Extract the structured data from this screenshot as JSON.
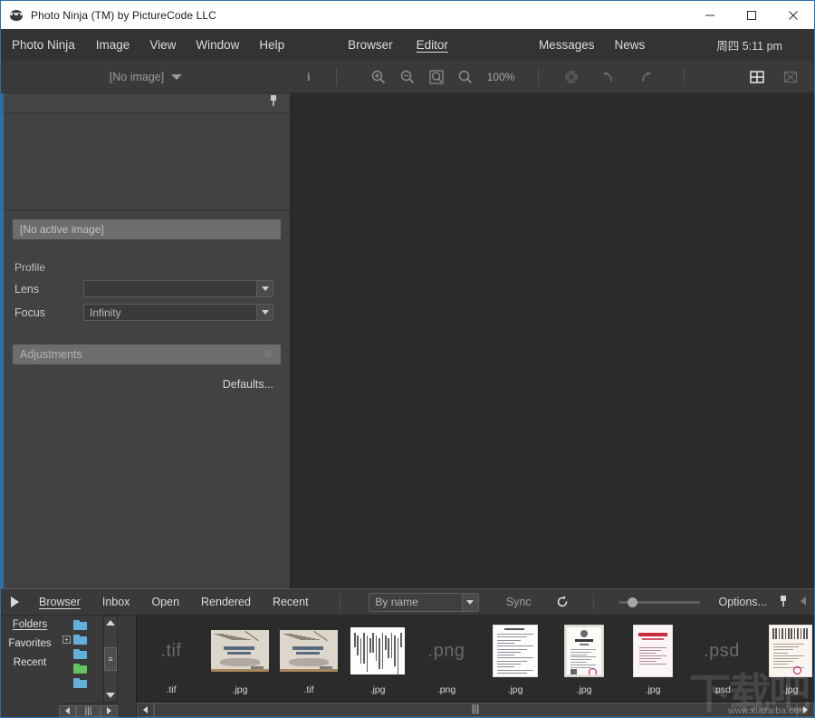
{
  "window": {
    "title": "Photo Ninja (TM) by PictureCode LLC",
    "app_icon": "ninja-icon",
    "minimize_label": "Minimize",
    "maximize_label": "Maximize",
    "close_label": "Close"
  },
  "menubar": {
    "menus": [
      {
        "label": "Photo Ninja"
      },
      {
        "label": "Image"
      },
      {
        "label": "View"
      },
      {
        "label": "Window"
      },
      {
        "label": "Help"
      }
    ],
    "modes": [
      {
        "label": "Browser",
        "active": false
      },
      {
        "label": "Editor",
        "active": true
      }
    ],
    "links": [
      {
        "label": "Messages"
      },
      {
        "label": "News"
      }
    ],
    "clock": "周四 5:11 pm",
    "collapse_icon": "chevron-up-icon",
    "pin_icon": "pin-icon"
  },
  "toolbar": {
    "image_selector": "[No image]",
    "dropdown_icon": "chevron-down-icon",
    "info_icon": "info-icon",
    "zoom_in_icon": "zoom-in-icon",
    "zoom_out_icon": "zoom-out-icon",
    "zoom_fit_icon": "zoom-fit-icon",
    "zoom_actual_icon": "zoom-actual-icon",
    "zoom_level": "100%",
    "pan_icon": "pan-icon",
    "undo_icon": "undo-icon",
    "redo_icon": "redo-icon",
    "grid_view_icon": "grid-view-icon",
    "single_view_icon": "single-view-icon"
  },
  "left_panel": {
    "pin_icon": "pin-icon",
    "active_image": "[No active image]",
    "profile_label": "Profile",
    "fields": [
      {
        "label": "Lens",
        "value": ""
      },
      {
        "label": "Focus",
        "value": "Infinity"
      }
    ],
    "adjustments_label": "Adjustments",
    "adjustments_icon": "gear-icon",
    "defaults_label": "Defaults..."
  },
  "browser_bar": {
    "expand_icon": "triangle-right-icon",
    "tabs": [
      {
        "label": "Browser",
        "active": true
      },
      {
        "label": "Inbox",
        "active": false
      },
      {
        "label": "Open",
        "active": false
      },
      {
        "label": "Rendered",
        "active": false
      },
      {
        "label": "Recent",
        "active": false
      }
    ],
    "sort_value": "By name",
    "sort_dropdown_icon": "chevron-down-icon",
    "sync_label": "Sync",
    "refresh_icon": "refresh-icon",
    "zoom_slider_value": 15,
    "options_label": "Options...",
    "pin_icon": "pin-icon",
    "collapse_icon": "triangle-left-icon"
  },
  "folders_pane": {
    "tabs": [
      {
        "label": "Folders",
        "active": true
      },
      {
        "label": "Favorites",
        "active": false
      },
      {
        "label": "Recent",
        "active": false
      }
    ],
    "tree_rows": [
      {
        "expander": "",
        "color": "#64b0dd",
        "indent": 0
      },
      {
        "expander": "+",
        "color": "#64b0dd",
        "indent": 0
      },
      {
        "expander": "",
        "color": "#64b0dd",
        "indent": 0
      },
      {
        "expander": "",
        "color": "#62c462",
        "indent": 0
      },
      {
        "expander": "",
        "color": "#64b0dd",
        "indent": 0
      }
    ],
    "scroll_up_icon": "triangle-up-icon",
    "scroll_down_icon": "triangle-down-icon",
    "scroll_left_icon": "triangle-left-icon",
    "scroll_right_icon": "triangle-right-icon"
  },
  "thumbnails": [
    {
      "name": ".tif",
      "kind": "placeholder",
      "ext_text": ".tif"
    },
    {
      "name": ".jpg",
      "kind": "document",
      "style": "diagram-dark"
    },
    {
      "name": ".tif",
      "kind": "document",
      "style": "diagram-dark"
    },
    {
      "name": ".jpg",
      "kind": "document",
      "style": "handwriting"
    },
    {
      "name": ".png",
      "kind": "placeholder",
      "ext_text": ".png"
    },
    {
      "name": ".jpg",
      "kind": "document",
      "style": "text-page"
    },
    {
      "name": ".jpg",
      "kind": "document",
      "style": "certificate"
    },
    {
      "name": ".jpg",
      "kind": "document",
      "style": "red-header"
    },
    {
      "name": ".psd",
      "kind": "placeholder",
      "ext_text": ".psd"
    },
    {
      "name": ".jpg",
      "kind": "document",
      "style": "lined-page"
    }
  ],
  "watermark": {
    "logo_text": "下载吧",
    "url_text": "www.xiazaiba.com"
  },
  "colors": {
    "accent_blue": "#2f6fa8",
    "panel_gray": "#424242",
    "canvas_dark": "#2b2b2b",
    "menubar": "#333333",
    "toolbar": "#3a3a3a",
    "folder_blue": "#64b0dd",
    "folder_green": "#62c462"
  }
}
